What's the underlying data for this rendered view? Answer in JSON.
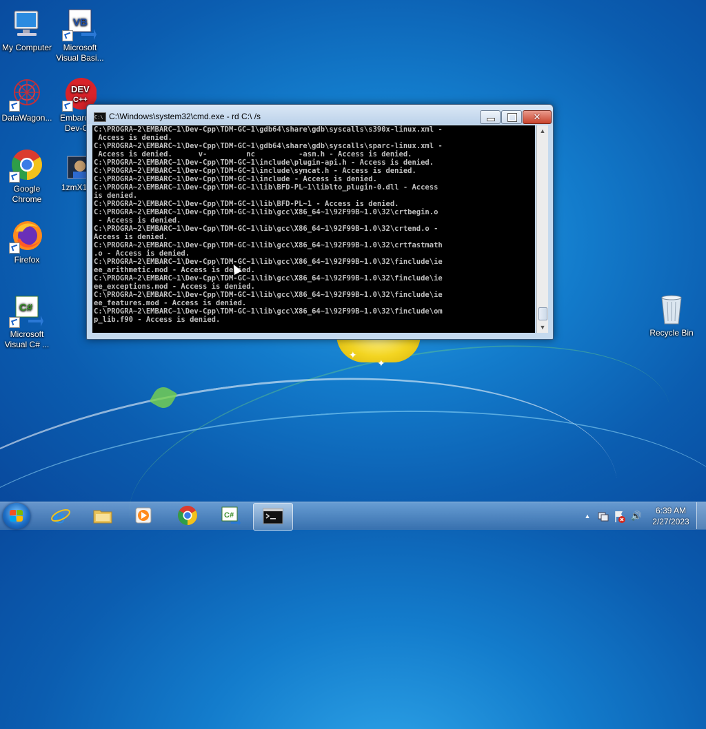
{
  "desktop": {
    "icons": [
      {
        "label": "My Computer"
      },
      {
        "label": "Microsoft Visual Basi..."
      },
      {
        "label": "DataWagon..."
      },
      {
        "label": "Embarca... Dev-C..."
      },
      {
        "label": "Google Chrome"
      },
      {
        "label": "1zmX12..."
      },
      {
        "label": "Firefox"
      },
      {
        "label": "Microsoft Visual C# ..."
      },
      {
        "label": "Recycle Bin"
      }
    ]
  },
  "window": {
    "title": "C:\\Windows\\system32\\cmd.exe - rd  C:\\ /s",
    "close_glyph": "✕",
    "console_text": "C:\\PROGRA~2\\EMBARC~1\\Dev-Cpp\\TDM-GC~1\\gdb64\\share\\gdb\\syscalls\\s390x-linux.xml -\n Access is denied.\nC:\\PROGRA~2\\EMBARC~1\\Dev-Cpp\\TDM-GC~1\\gdb64\\share\\gdb\\syscalls\\sparc-linux.xml -\n Access is denied.      v-         nc          -asm.h - Access is denied.\nC:\\PROGRA~2\\EMBARC~1\\Dev-Cpp\\TDM-GC~1\\include\\plugin-api.h - Access is denied.\nC:\\PROGRA~2\\EMBARC~1\\Dev-Cpp\\TDM-GC~1\\include\\symcat.h - Access is denied.\nC:\\PROGRA~2\\EMBARC~1\\Dev-Cpp\\TDM-GC~1\\include - Access is denied.\nC:\\PROGRA~2\\EMBARC~1\\Dev-Cpp\\TDM-GC~1\\lib\\BFD-PL~1\\liblto_plugin-0.dll - Access\nis denied.\nC:\\PROGRA~2\\EMBARC~1\\Dev-Cpp\\TDM-GC~1\\lib\\BFD-PL~1 - Access is denied.\nC:\\PROGRA~2\\EMBARC~1\\Dev-Cpp\\TDM-GC~1\\lib\\gcc\\X86_64~1\\92F99B~1.0\\32\\crtbegin.o\n - Access is denied.\nC:\\PROGRA~2\\EMBARC~1\\Dev-Cpp\\TDM-GC~1\\lib\\gcc\\X86_64~1\\92F99B~1.0\\32\\crtend.o -\nAccess is denied.\nC:\\PROGRA~2\\EMBARC~1\\Dev-Cpp\\TDM-GC~1\\lib\\gcc\\X86_64~1\\92F99B~1.0\\32\\crtfastmath\n.o - Access is denied.\nC:\\PROGRA~2\\EMBARC~1\\Dev-Cpp\\TDM-GC~1\\lib\\gcc\\X86_64~1\\92F99B~1.0\\32\\finclude\\ie\nee_arithmetic.mod - Access is denied.\nC:\\PROGRA~2\\EMBARC~1\\Dev-Cpp\\TDM-GC~1\\lib\\gcc\\X86_64~1\\92F99B~1.0\\32\\finclude\\ie\nee_exceptions.mod - Access is denied.\nC:\\PROGRA~2\\EMBARC~1\\Dev-Cpp\\TDM-GC~1\\lib\\gcc\\X86_64~1\\92F99B~1.0\\32\\finclude\\ie\nee_features.mod - Access is denied.\nC:\\PROGRA~2\\EMBARC~1\\Dev-Cpp\\TDM-GC~1\\lib\\gcc\\X86_64~1\\92F99B~1.0\\32\\finclude\\om\np_lib.f90 - Access is denied.",
    "scroll_up": "▲",
    "scroll_down": "▼"
  },
  "taskbar": {
    "pinned": [
      {
        "name": "internet-explorer"
      },
      {
        "name": "windows-explorer"
      },
      {
        "name": "media-player"
      },
      {
        "name": "google-chrome"
      },
      {
        "name": "visual-csharp"
      },
      {
        "name": "command-prompt",
        "active": true
      }
    ],
    "tray": {
      "expand_glyph": "▲",
      "volume_glyph": "🔊"
    },
    "clock": {
      "time": "6:39 AM",
      "date": "2/27/2023"
    }
  },
  "colors": {
    "console_bg": "#000000",
    "console_fg": "#c0c0c0",
    "close_button": "#c9442d",
    "desktop_blue": "#137ccc"
  }
}
